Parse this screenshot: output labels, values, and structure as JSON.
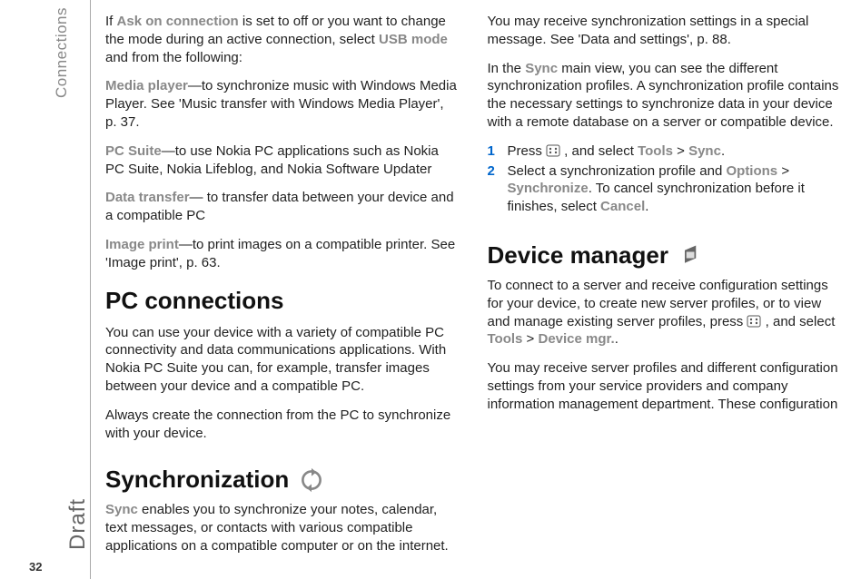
{
  "sidebar": {
    "category": "Connections",
    "watermark": "Draft",
    "page_number": "32"
  },
  "left": {
    "p1": {
      "a": "If ",
      "b": "Ask on connection",
      "c": " is set to off or you want to change the mode during an active connection, select ",
      "d": "USB mode",
      "e": " and from the following:"
    },
    "media": {
      "label": "Media player",
      "text": "—to synchronize music with Windows Media Player. See 'Music transfer with Windows Media Player', p. 37."
    },
    "pcsuite": {
      "label": "PC Suite",
      "text": "—to use Nokia PC applications such as Nokia PC Suite, Nokia Lifeblog, and Nokia Software Updater"
    },
    "datatransfer": {
      "label": "Data transfer",
      "text": "— to transfer data between your device and a compatible PC"
    },
    "imageprint": {
      "label": "Image print",
      "text": "—to print images on a compatible printer. See 'Image print', p. 63."
    },
    "h_pcconn": "PC connections",
    "pcconn_p1": "You can use your device with a variety of compatible PC connectivity and data communications applications. With Nokia PC Suite you can, for example, transfer images between your device and a compatible PC.",
    "pcconn_p2": "Always create the connection from the PC to synchronize with your device."
  },
  "right": {
    "h_sync": "Synchronization",
    "sync_p1": {
      "a": "Sync",
      "b": " enables you to synchronize your notes, calendar, text messages, or contacts with various compatible applications on a compatible computer or on the internet."
    },
    "sync_p2": "You may receive synchronization settings in a special message. See 'Data and settings', p. 88.",
    "sync_p3": {
      "a": "In the ",
      "b": "Sync",
      "c": " main view, you can see the different synchronization profiles. A synchronization profile contains the necessary settings to synchronize data in your device with a remote database on a server or compatible device."
    },
    "steps": [
      {
        "num": "1",
        "a": "Press ",
        "c": " , and select ",
        "d": "Tools",
        "e": " > ",
        "f": "Sync",
        "g": "."
      },
      {
        "num": "2",
        "a": "Select a synchronization profile and ",
        "b": "Options",
        "c": " > ",
        "d": "Synchronize",
        "e": ". To cancel synchronization before it finishes, select ",
        "f": "Cancel",
        "g": "."
      }
    ],
    "h_devmgr": "Device manager",
    "dev_p1": {
      "a": "To connect to a server and receive configuration settings for your device, to create new server profiles, or to view and manage existing server profiles, press ",
      "c": " , and select ",
      "d": "Tools",
      "e": " > ",
      "f": "Device mgr.",
      "g": "."
    },
    "dev_p2": "You may receive server profiles and different configuration settings from your service providers and company information management department. These configuration"
  }
}
